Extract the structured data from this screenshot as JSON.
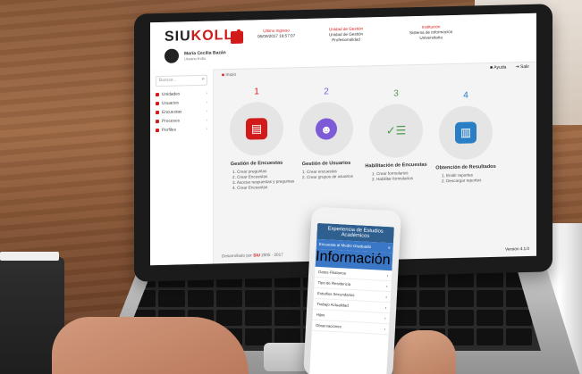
{
  "screen": {
    "logo": {
      "prefix": "SIU",
      "accent": "KOLLA"
    },
    "user": {
      "name": "María Cecilia Bazán",
      "role": "Usuario Kolla"
    },
    "header": {
      "col1": {
        "title": "Último Ingreso",
        "line1": "06/09/2017 18:57:07"
      },
      "col2": {
        "title": "Unidad de Gestión",
        "line1": "Unidad de Gestión",
        "line2": "Profesionalidad"
      },
      "col3": {
        "title": "Institución",
        "line1": "Sistema de Información",
        "line2": "Universitaria"
      }
    },
    "search": {
      "placeholder": "Buscar..."
    },
    "sidebar": {
      "items": [
        {
          "label": "Unidades"
        },
        {
          "label": "Usuarios"
        },
        {
          "label": "Encuestas"
        },
        {
          "label": "Procesos"
        },
        {
          "label": "Perfiles"
        }
      ]
    },
    "breadcrumb": {
      "home": "Inicio"
    },
    "top_actions": {
      "help": "Ayuda",
      "exit": "Salir"
    },
    "steps": [
      {
        "number": "1",
        "title": "Gestión de Encuestas",
        "items": [
          "1. Crear preguntas",
          "2. Crear Encuestas",
          "3. Asociar respuestas y preguntas",
          "4. Crear Encuestas"
        ]
      },
      {
        "number": "2",
        "title": "Gestión de Usuarios",
        "items": [
          "1. Crear encuestas",
          "2. Crear grupos de usuarios"
        ]
      },
      {
        "number": "3",
        "title": "Habilitación de Encuestas",
        "items": [
          "1. Crear formularios",
          "2. Habilitar formularios"
        ]
      },
      {
        "number": "4",
        "title": "Obtención de Resultados",
        "items": [
          "1. Emitir reportes",
          "2. Descargar reportes"
        ]
      }
    ],
    "footer": {
      "left_prefix": "Desarrollado por",
      "left_brand": "SIU",
      "left_suffix": "2005 - 2017",
      "right": "Versión 4.1.0"
    }
  },
  "phone": {
    "title": "Experiencia de Estudios Académicos",
    "banner": "Encuesta al Medio Graduado",
    "banner_sub": "Información",
    "rows": [
      {
        "label": "Datos Filiatorios"
      },
      {
        "label": "Tipo de Residencia"
      },
      {
        "label": "Estudios Secundarios"
      },
      {
        "label": "Trabajo Actualidad"
      },
      {
        "label": "Hijos"
      },
      {
        "label": "Observaciones"
      }
    ]
  },
  "colors": {
    "accent_red": "#d11a1a",
    "step1": "#d11a1a",
    "step2": "#7d5bd6",
    "step3": "#4e9a4e",
    "step4": "#2a7ec4"
  }
}
